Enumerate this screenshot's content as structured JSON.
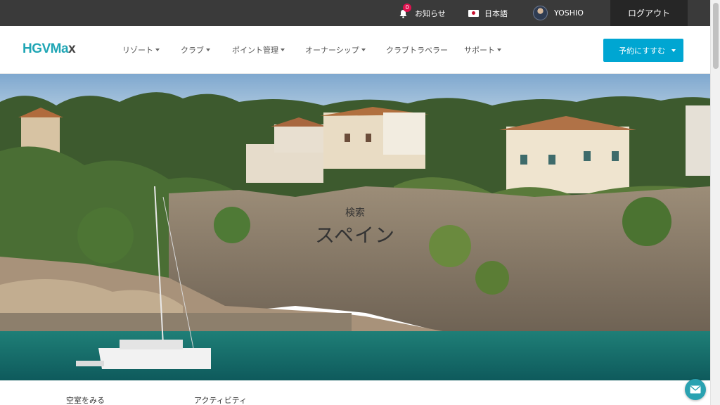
{
  "topbar": {
    "notifications_label": "お知らせ",
    "notifications_count": "0",
    "language_label": "日本語",
    "username": "YOSHIO",
    "logout_label": "ログアウト"
  },
  "nav": {
    "logo_main": "HGVMa",
    "logo_accent": "x",
    "items": [
      {
        "label": "リゾート"
      },
      {
        "label": "クラブ"
      },
      {
        "label": "ポイント管理"
      },
      {
        "label": "オーナーシップ"
      },
      {
        "label": "クラブトラベラー"
      },
      {
        "label": "サポート"
      }
    ],
    "reserve_label": "予約にすすむ"
  },
  "hero": {
    "subtitle": "検索",
    "title": "スペイン"
  },
  "tabs": [
    {
      "label": "空室をみる"
    },
    {
      "label": "アクティビティ"
    }
  ],
  "icons": {
    "bell": "bell-icon",
    "flag": "japan-flag-icon",
    "chat": "mail-icon"
  },
  "colors": {
    "accent": "#00a6d2",
    "brand": "#20a6b5",
    "topbar": "#3a3a3a",
    "badge": "#e0114f"
  }
}
